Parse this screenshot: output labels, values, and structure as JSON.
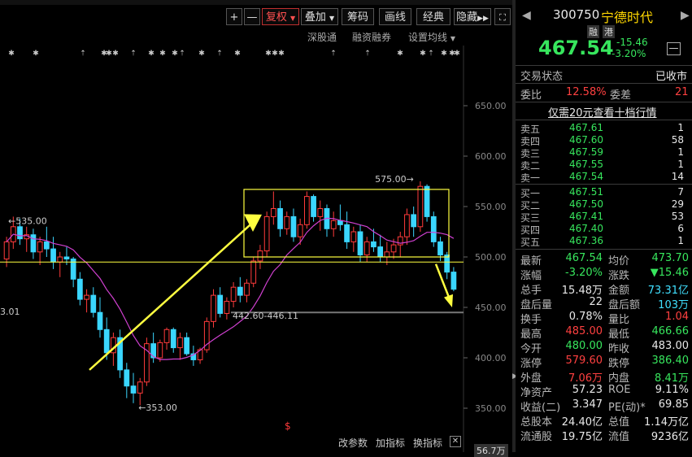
{
  "toolbar": {
    "plus": "+",
    "minus": "—",
    "fuquan": "复权",
    "diejia": "叠加",
    "chouma": "筹码",
    "huaxian": "画线",
    "jingdian": "经典",
    "yincang": "隐藏"
  },
  "subbar": {
    "shengutong": "深股通",
    "rongzi": "融资融券",
    "junxian": "设置均线"
  },
  "chart_data": {
    "type": "candlestick",
    "y_ticks": [
      "650.00",
      "600.00",
      "550.00",
      "500.00",
      "450.00",
      "400.00",
      "350.00"
    ],
    "ylim": [
      330,
      680
    ],
    "annotations": {
      "high_label": "575.00",
      "left_high_label": "535.00",
      "low_label": "353.00",
      "left_edge_label": "3.01",
      "gap_label": "442.60-446.11"
    },
    "candles": [
      [
        498,
        520,
        490,
        515
      ],
      [
        515,
        540,
        508,
        530
      ],
      [
        530,
        538,
        512,
        518
      ],
      [
        518,
        530,
        505,
        522
      ],
      [
        522,
        528,
        498,
        505
      ],
      [
        505,
        520,
        492,
        515
      ],
      [
        515,
        530,
        500,
        508
      ],
      [
        508,
        520,
        488,
        495
      ],
      [
        495,
        505,
        480,
        500
      ],
      [
        500,
        510,
        492,
        498
      ],
      [
        498,
        500,
        470,
        478
      ],
      [
        478,
        485,
        452,
        458
      ],
      [
        458,
        468,
        445,
        462
      ],
      [
        462,
        470,
        440,
        445
      ],
      [
        445,
        460,
        420,
        428
      ],
      [
        428,
        440,
        398,
        405
      ],
      [
        405,
        425,
        392,
        420
      ],
      [
        420,
        428,
        380,
        388
      ],
      [
        388,
        395,
        360,
        372
      ],
      [
        372,
        385,
        355,
        365
      ],
      [
        365,
        380,
        353,
        376
      ],
      [
        376,
        420,
        372,
        414
      ],
      [
        414,
        425,
        395,
        400
      ],
      [
        400,
        418,
        396,
        415
      ],
      [
        415,
        430,
        408,
        428
      ],
      [
        428,
        430,
        405,
        410
      ],
      [
        410,
        425,
        398,
        420
      ],
      [
        420,
        425,
        402,
        404
      ],
      [
        404,
        412,
        392,
        398
      ],
      [
        398,
        410,
        394,
        408
      ],
      [
        408,
        440,
        405,
        436
      ],
      [
        436,
        468,
        430,
        462
      ],
      [
        462,
        470,
        440,
        444
      ],
      [
        444,
        460,
        438,
        456
      ],
      [
        456,
        475,
        450,
        470
      ],
      [
        470,
        480,
        455,
        462
      ],
      [
        462,
        478,
        455,
        474
      ],
      [
        474,
        500,
        470,
        496
      ],
      [
        496,
        512,
        488,
        506
      ],
      [
        506,
        545,
        500,
        540
      ],
      [
        540,
        565,
        532,
        548
      ],
      [
        548,
        556,
        520,
        528
      ],
      [
        528,
        545,
        522,
        540
      ],
      [
        540,
        548,
        515,
        520
      ],
      [
        520,
        538,
        512,
        532
      ],
      [
        532,
        565,
        528,
        560
      ],
      [
        560,
        562,
        535,
        540
      ],
      [
        540,
        556,
        526,
        548
      ],
      [
        548,
        552,
        520,
        528
      ],
      [
        528,
        545,
        520,
        536
      ],
      [
        536,
        552,
        526,
        532
      ],
      [
        532,
        545,
        508,
        515
      ],
      [
        515,
        530,
        505,
        525
      ],
      [
        525,
        532,
        495,
        502
      ],
      [
        502,
        520,
        495,
        515
      ],
      [
        515,
        528,
        505,
        510
      ],
      [
        510,
        522,
        495,
        500
      ],
      [
        500,
        515,
        492,
        505
      ],
      [
        505,
        518,
        498,
        512
      ],
      [
        512,
        525,
        500,
        520
      ],
      [
        520,
        548,
        512,
        542
      ],
      [
        542,
        550,
        520,
        530
      ],
      [
        530,
        575,
        525,
        570
      ],
      [
        570,
        572,
        535,
        540
      ],
      [
        540,
        545,
        510,
        515
      ],
      [
        515,
        520,
        496,
        502
      ],
      [
        502,
        505,
        478,
        485
      ],
      [
        485,
        490,
        466,
        468
      ]
    ]
  },
  "chart_bottom": {
    "gaicanshu": "改参数",
    "jiazhibiao": "加指标",
    "huanzhibiao": "换指标",
    "volume": "56.7万"
  },
  "stock": {
    "code": "300750",
    "name": "宁德时代",
    "tag_rong": "融",
    "tag_gang": "港",
    "price": "467.54",
    "change": "-15.46",
    "change_pct": "-3.20%",
    "status_label": "交易状态",
    "status_value": "已收市",
    "weibi_label": "委比",
    "weibi_value": "12.58%",
    "weicha_label": "委差",
    "weicha_value": "21",
    "promo": "仅需20元查看十档行情"
  },
  "asks": [
    {
      "label": "卖五",
      "price": "467.61",
      "vol": "1"
    },
    {
      "label": "卖四",
      "price": "467.60",
      "vol": "58"
    },
    {
      "label": "卖三",
      "price": "467.59",
      "vol": "1"
    },
    {
      "label": "卖二",
      "price": "467.55",
      "vol": "1"
    },
    {
      "label": "卖一",
      "price": "467.54",
      "vol": "14"
    }
  ],
  "bids": [
    {
      "label": "买一",
      "price": "467.51",
      "vol": "7"
    },
    {
      "label": "买二",
      "price": "467.50",
      "vol": "29"
    },
    {
      "label": "买三",
      "price": "467.41",
      "vol": "53"
    },
    {
      "label": "买四",
      "price": "467.40",
      "vol": "6"
    },
    {
      "label": "买五",
      "price": "467.36",
      "vol": "1"
    }
  ],
  "stats": [
    {
      "l1": "最新",
      "v1": "467.54",
      "c1": "green",
      "l2": "均价",
      "v2": "473.70",
      "c2": "green"
    },
    {
      "l1": "涨幅",
      "v1": "-3.20%",
      "c1": "green",
      "l2": "涨跌",
      "v2": "▼15.46",
      "c2": "green"
    },
    {
      "l1": "总手",
      "v1": "15.48万",
      "c1": "white",
      "l2": "金额",
      "v2": "73.31亿",
      "c2": "cyan"
    },
    {
      "l1": "盘后量",
      "v1": "22",
      "c1": "white",
      "l2": "盘后额",
      "v2": "103万",
      "c2": "cyan"
    },
    {
      "l1": "换手",
      "v1": "0.78%",
      "c1": "white",
      "l2": "量比",
      "v2": "1.04",
      "c2": "red"
    },
    {
      "l1": "最高",
      "v1": "485.00",
      "c1": "red",
      "l2": "最低",
      "v2": "466.66",
      "c2": "green"
    },
    {
      "l1": "今开",
      "v1": "480.00",
      "c1": "green",
      "l2": "昨收",
      "v2": "483.00",
      "c2": "white"
    },
    {
      "l1": "涨停",
      "v1": "579.60",
      "c1": "red",
      "l2": "跌停",
      "v2": "386.40",
      "c2": "green"
    },
    {
      "l1": "外盘",
      "v1": "7.06万",
      "c1": "red",
      "l2": "内盘",
      "v2": "8.41万",
      "c2": "green"
    },
    {
      "l1": "净资产",
      "v1": "57.23",
      "c1": "white",
      "l2": "ROE",
      "v2": "9.11%",
      "c2": "white"
    },
    {
      "l1": "收益(二)",
      "v1": "3.347",
      "c1": "white",
      "l2": "PE(动)*",
      "v2": "69.85",
      "c2": "white"
    },
    {
      "l1": "总股本",
      "v1": "24.40亿",
      "c1": "white",
      "l2": "总值",
      "v2": "1.14万亿",
      "c2": "white"
    },
    {
      "l1": "流通股",
      "v1": "19.75亿",
      "c1": "white",
      "l2": "流值",
      "v2": "9236亿",
      "c2": "white"
    }
  ]
}
